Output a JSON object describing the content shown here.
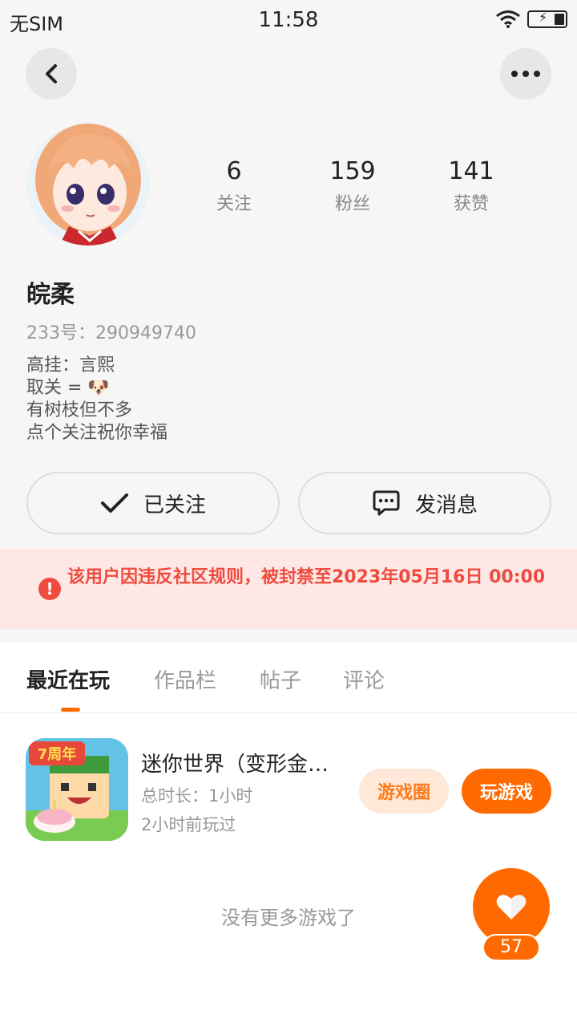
{
  "status_bar": {
    "carrier": "无SIM",
    "time": "11:58"
  },
  "profile": {
    "stats": [
      {
        "value": "6",
        "label": "关注"
      },
      {
        "value": "159",
        "label": "粉丝"
      },
      {
        "value": "141",
        "label": "获赞"
      }
    ],
    "nickname": "皖柔",
    "user_id": "233号：290949740",
    "bio": [
      "高挂：言熙",
      "取关 = 🐶",
      "有树枝但不多",
      "点个关注祝你幸福"
    ]
  },
  "actions": {
    "follow_label": "已关注",
    "message_label": "发消息"
  },
  "ban_notice": {
    "text": "该用户因违反社区规则，被封禁至2023年05月16日 00:00"
  },
  "tabs": [
    {
      "label": "最近在玩",
      "active": true
    },
    {
      "label": "作品栏",
      "active": false
    },
    {
      "label": "帖子",
      "active": false
    },
    {
      "label": "评论",
      "active": false
    }
  ],
  "games": [
    {
      "title": "迷你世界（变形金刚联动）",
      "duration": "总时长：1小时",
      "last_played": "2小时前玩过",
      "icon_badge": "7周年",
      "circle_label": "游戏圈",
      "play_label": "玩游戏"
    }
  ],
  "no_more_text": "没有更多游戏了",
  "like_fab": {
    "count": "57"
  },
  "colors": {
    "accent": "#ff6a00",
    "danger": "#f04b3e",
    "ban_bg": "#fde8e6"
  }
}
